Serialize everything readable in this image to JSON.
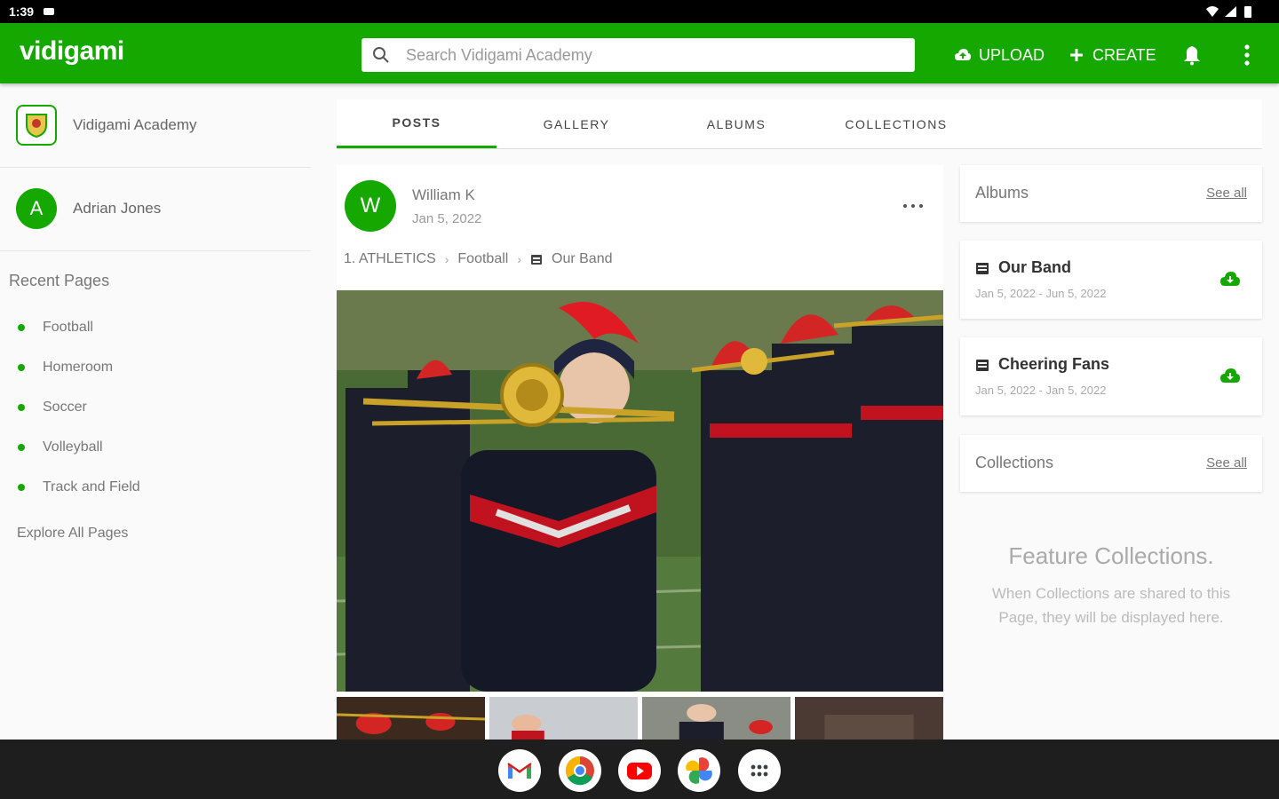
{
  "status_bar": {
    "time": "1:39"
  },
  "app": {
    "logo": "vidigami",
    "search_placeholder": "Search Vidigami Academy",
    "upload_label": "UPLOAD",
    "create_label": "CREATE"
  },
  "sidebar": {
    "org_name": "Vidigami Academy",
    "user_initial": "A",
    "user_name": "Adrian Jones",
    "recent_title": "Recent Pages",
    "recent_pages": [
      "Football",
      "Homeroom",
      "Soccer",
      "Volleyball",
      "Track and Field"
    ],
    "explore_label": "Explore All Pages"
  },
  "tabs": [
    "POSTS",
    "GALLERY",
    "ALBUMS",
    "COLLECTIONS"
  ],
  "post": {
    "author_initial": "W",
    "author": "William K",
    "date": "Jan 5, 2022",
    "breadcrumb": [
      "1. ATHLETICS",
      "Football",
      "Our Band"
    ]
  },
  "right": {
    "albums_title": "Albums",
    "see_all": "See all",
    "albums": [
      {
        "name": "Our Band",
        "range": "Jan 5, 2022 - Jun 5, 2022"
      },
      {
        "name": "Cheering Fans",
        "range": "Jan 5, 2022 - Jan 5, 2022"
      }
    ],
    "collections_title": "Collections",
    "empty_title": "Feature Collections.",
    "empty_text": "When Collections are shared to this Page, they will be displayed here."
  },
  "colors": {
    "brand": "#14a800"
  },
  "dock_apps": [
    "gmail-icon",
    "chrome-icon",
    "youtube-icon",
    "photos-icon",
    "app-drawer-icon"
  ]
}
